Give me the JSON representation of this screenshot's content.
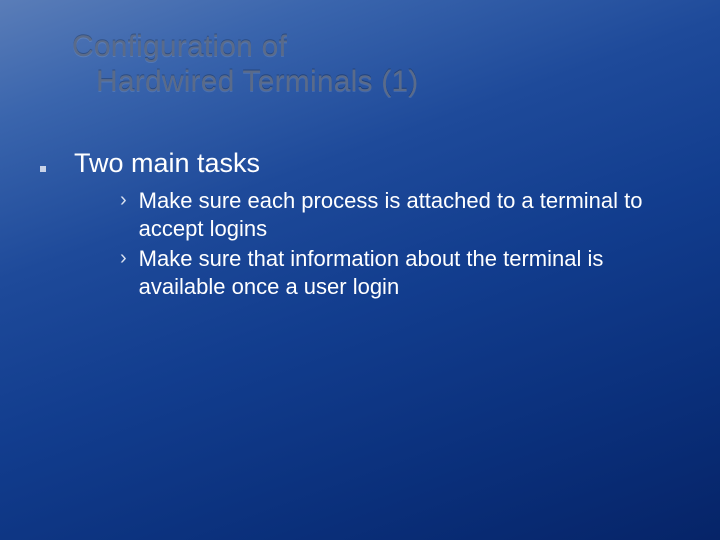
{
  "title": {
    "line1": "Configuration of",
    "line2": "Hardwired Terminals (1)"
  },
  "main_bullet": "Two main tasks",
  "sub_bullets": [
    "Make sure each process is attached to a terminal to accept logins",
    "Make sure that information about the terminal is available once a user login"
  ],
  "glyphs": {
    "chevron": "›"
  }
}
